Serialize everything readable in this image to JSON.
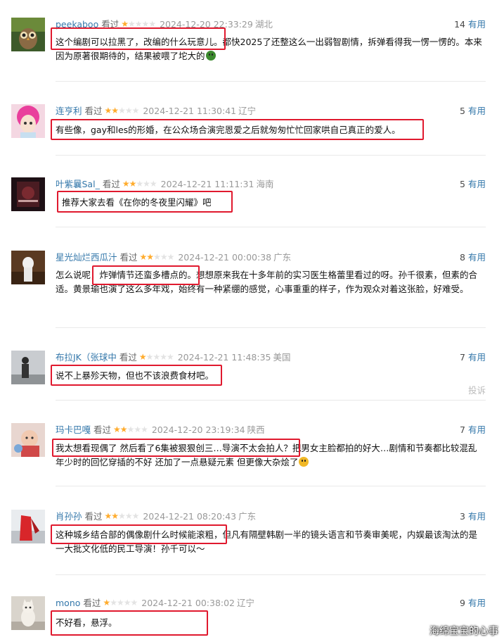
{
  "colors": {
    "link": "#3377aa",
    "star_on": "#ffac2d",
    "star_off": "#e3e3e3",
    "highlight": "#e0192e"
  },
  "reviews": [
    {
      "user": "peekaboo",
      "status": "看过",
      "stars": 1,
      "time": "2024-12-20 22:33:29",
      "location": "湖北",
      "useful_count": "14",
      "useful_label": "有用",
      "content": "这个编剧可以拉黑了，改编的什么玩意儿。都快2025了还整这么一出弱智剧情，拆弹看得我一愣一愣的。本来因为原著很期待的，结果被喂了坨大的",
      "emoji": "nauseated-face-icon",
      "avatar": "owl-avatar"
    },
    {
      "user": "连亨利",
      "status": "看过",
      "stars": 2,
      "time": "2024-12-21 11:30:41",
      "location": "辽宁",
      "useful_count": "5",
      "useful_label": "有用",
      "content": "有些像，gay和les的形婚，在公众场合演完恩爱之后就匆匆忙忙回家哄自己真正的爱人。",
      "avatar": "pink-hair-avatar"
    },
    {
      "user": "叶紫曩Sal_",
      "status": "看过",
      "stars": 2,
      "time": "2024-12-21 11:11:31",
      "location": "海南",
      "useful_count": "5",
      "useful_label": "有用",
      "content": "推荐大家去看《在你的冬夜里闪耀》吧",
      "avatar": "movie-poster-avatar"
    },
    {
      "user": "星光灿烂西瓜汁",
      "status": "看过",
      "stars": 2,
      "time": "2024-12-21 00:00:38",
      "location": "广东",
      "useful_count": "8",
      "useful_label": "有用",
      "content": "怎么说呢，炸弹情节还蛮多槽点的。想想原来我在十多年前的实习医生格蕾里看过的呀。孙千很素，但素的合适。黄景瑜也演了这么多年戏，始终有一种紧绷的感觉，心事重重的样子，作为观众对着这张脸，好难受。",
      "avatar": "white-figure-avatar"
    },
    {
      "user": "布拉JK（张球中",
      "status": "看过",
      "stars": 1,
      "time": "2024-12-21 11:48:35",
      "location": "美国",
      "useful_count": "7",
      "useful_label": "有用",
      "content": "说不上暴殄天物，但也不该浪费食材吧。",
      "report": "投诉",
      "avatar": "person-silhouette-avatar"
    },
    {
      "user": "玛卡巴嘎",
      "status": "看过",
      "stars": 2,
      "time": "2024-12-20 23:19:34",
      "location": "陕西",
      "useful_count": "7",
      "useful_label": "有用",
      "content": "我太想看现偶了 然后看了6集被狠狠创三…导演不太会拍人？把男女主脸都拍的好大…剧情和节奏都比较混乱 年少时的回忆穿插的不好 还加了一点悬疑元素 但更像大杂烩了",
      "emoji": "grimace-face-icon",
      "avatar": "child-avatar"
    },
    {
      "user": "肖孙孙",
      "status": "看过",
      "stars": 2,
      "time": "2024-12-21 08:20:43",
      "location": "广东",
      "useful_count": "3",
      "useful_label": "有用",
      "content": "这种城乡结合部的偶像剧什么时候能滚粗，但凡有隔壁韩剧一半的镜头语言和节奏审美呢，内娱最该淘汰的是一大批文化低的民工导演！孙千可以～",
      "avatar": "red-figure-avatar"
    },
    {
      "user": "mono",
      "status": "看过",
      "stars": 1,
      "time": "2024-12-21 00:38:02",
      "location": "辽宁",
      "useful_count": "9",
      "useful_label": "有用",
      "content": "不好看，悬浮。",
      "avatar": "cat-avatar"
    }
  ],
  "watermark": "海绵宝宝的心事"
}
